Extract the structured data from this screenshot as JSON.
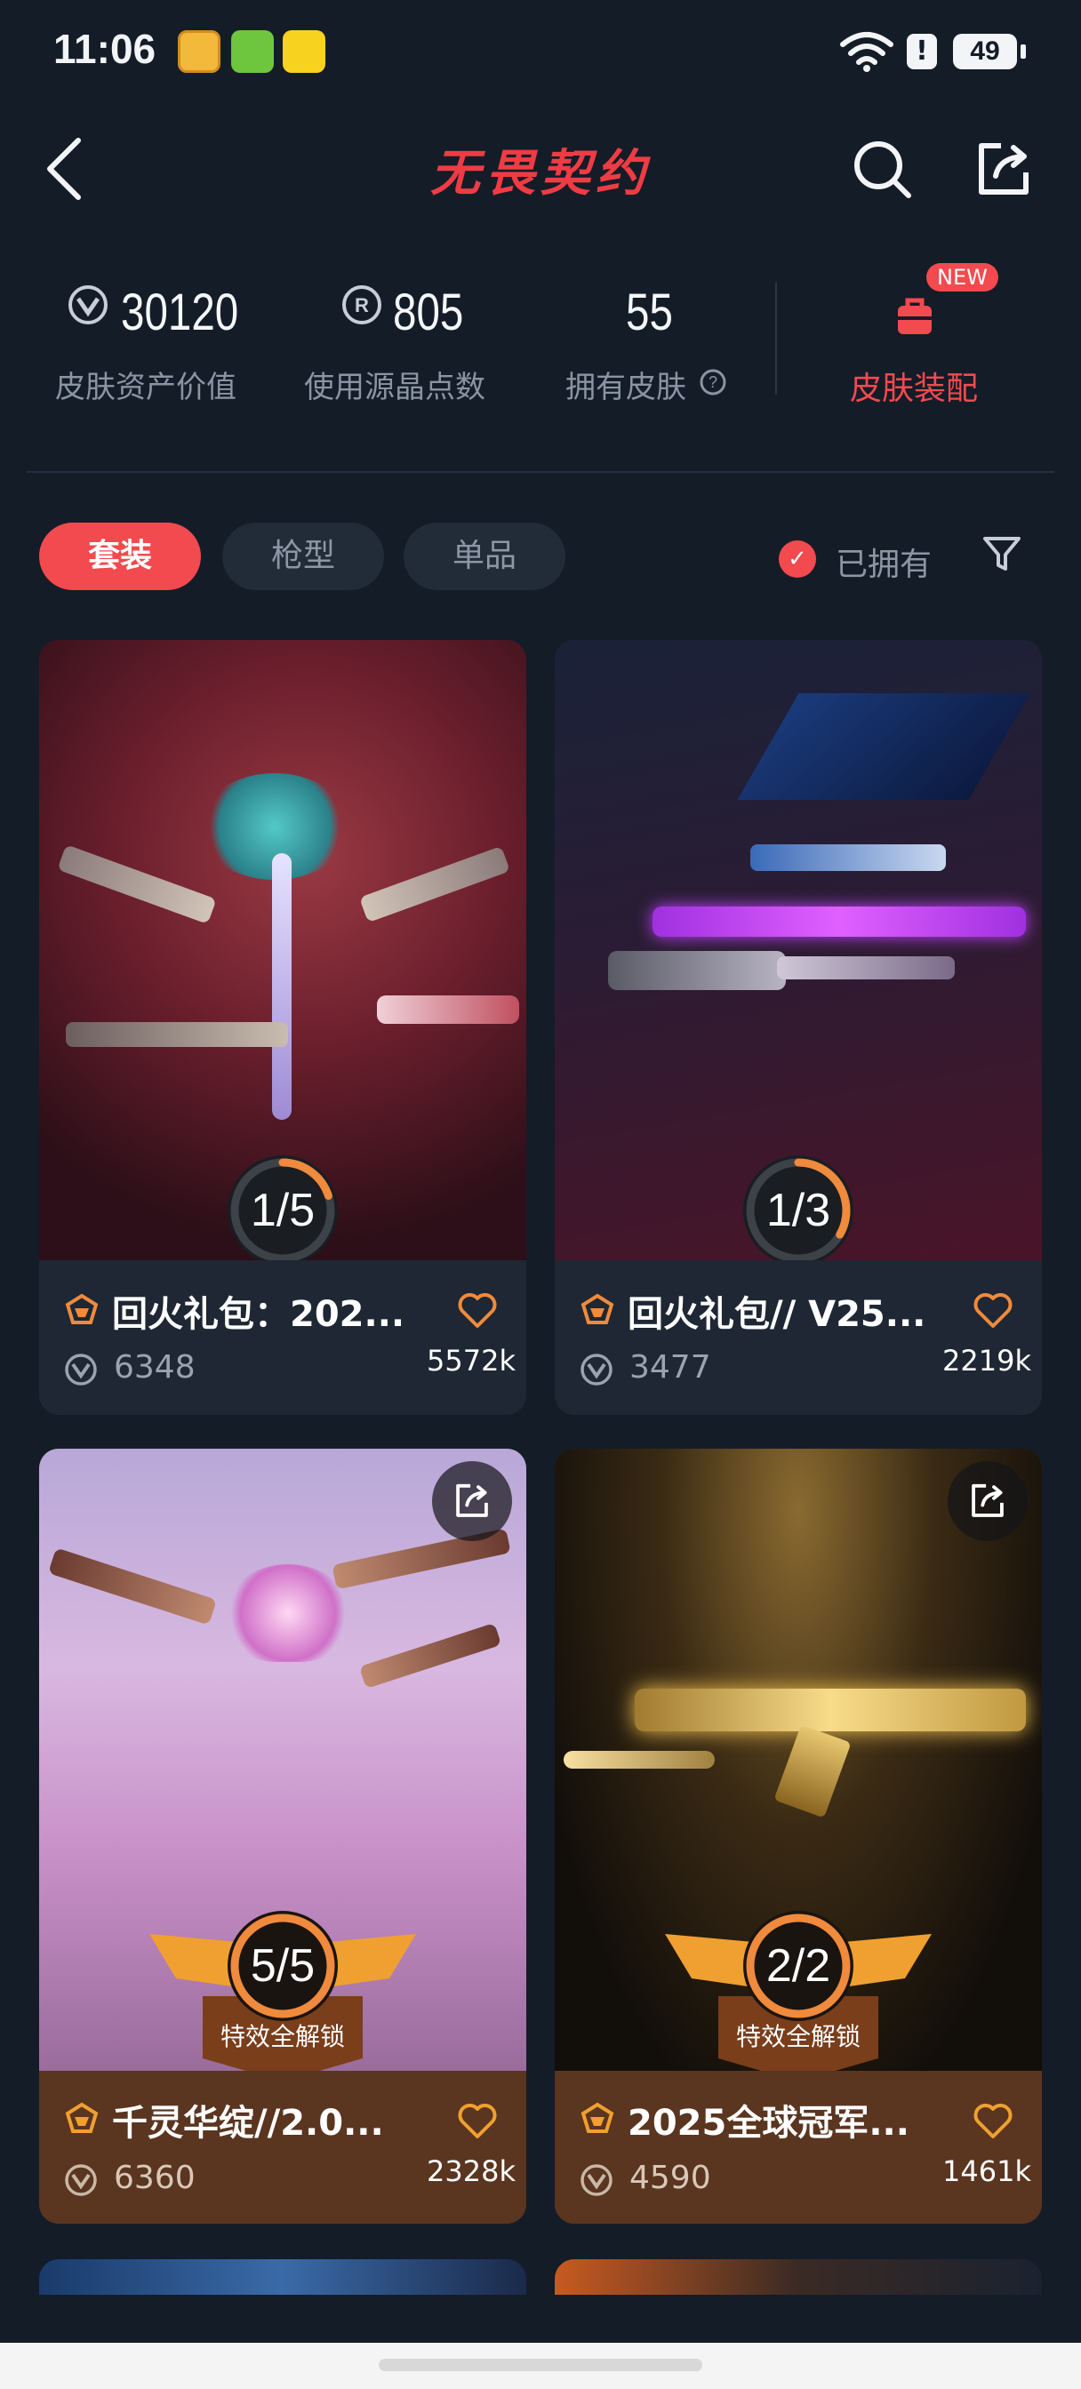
{
  "status_bar": {
    "time": "11:06",
    "battery": "49"
  },
  "header": {
    "title": "无畏契约"
  },
  "stats": [
    {
      "value": "30120",
      "label": "皮肤资产价值",
      "icon": "vp-coin-icon"
    },
    {
      "value": "805",
      "label": "使用源晶点数",
      "icon": "radianite-icon"
    },
    {
      "value": "55",
      "label": "拥有皮肤",
      "icon": "info-icon"
    }
  ],
  "loadout": {
    "label": "皮肤装配",
    "badge": "NEW"
  },
  "tabs": [
    {
      "label": "套装",
      "active": true
    },
    {
      "label": "枪型",
      "active": false
    },
    {
      "label": "单品",
      "active": false
    }
  ],
  "owned_filter": {
    "label": "已拥有",
    "checked": true
  },
  "cards": [
    {
      "title": "回火礼包：202...",
      "price": "6348",
      "popularity": "5572k",
      "progress": "1/5",
      "owned": 1,
      "total": 5,
      "unlocked_label": ""
    },
    {
      "title": "回火礼包// V25...",
      "price": "3477",
      "popularity": "2219k",
      "progress": "1/3",
      "owned": 1,
      "total": 3,
      "unlocked_label": ""
    },
    {
      "title": "千灵华绽//2.0...",
      "price": "6360",
      "popularity": "2328k",
      "progress": "5/5",
      "owned": 5,
      "total": 5,
      "unlocked_label": "特效全解锁"
    },
    {
      "title": "2025全球冠军...",
      "price": "4590",
      "popularity": "1461k",
      "progress": "2/2",
      "owned": 2,
      "total": 2,
      "unlocked_label": "特效全解锁"
    }
  ],
  "colors": {
    "accent": "#f24a4e",
    "progress_orange": "#f08a3c",
    "background": "#141c28"
  }
}
